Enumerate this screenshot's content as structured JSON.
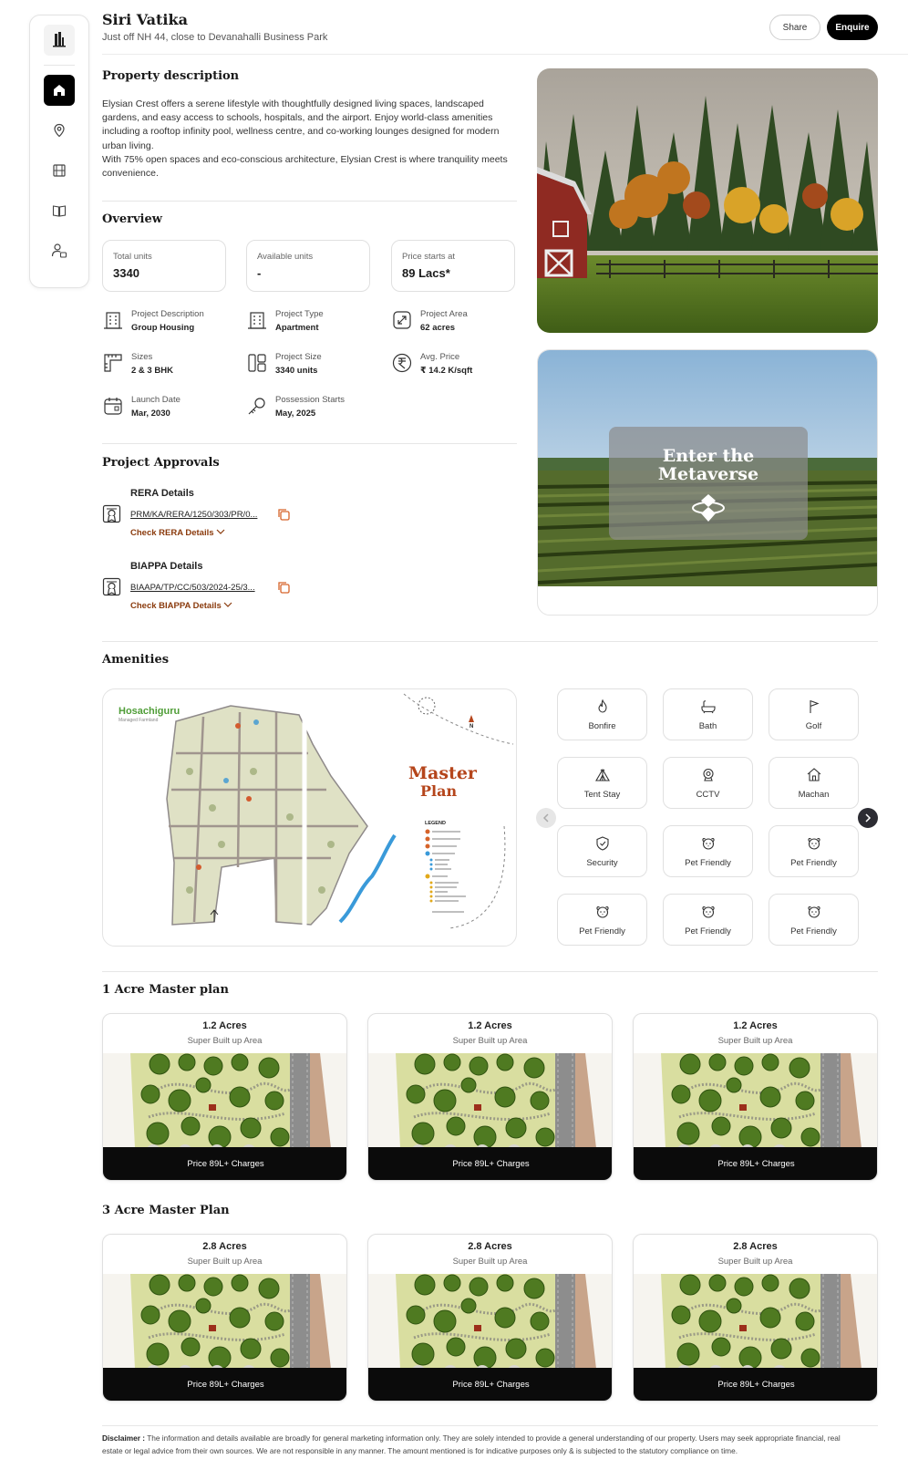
{
  "header": {
    "title": "Siri Vatika",
    "subtitle": "Just off NH 44, close to Devanahalli Business Park",
    "share_label": "Share",
    "enquire_label": "Enquire"
  },
  "sidebar": {
    "items": [
      {
        "icon": "home-icon",
        "active": true
      },
      {
        "icon": "location-pin-icon",
        "active": false
      },
      {
        "icon": "film-icon",
        "active": false
      },
      {
        "icon": "book-icon",
        "active": false
      },
      {
        "icon": "user-settings-icon",
        "active": false
      }
    ]
  },
  "description": {
    "title": "Property description",
    "para1": "Elysian Crest offers a serene lifestyle with thoughtfully designed living spaces, landscaped gardens, and easy access to schools, hospitals, and the airport. Enjoy world-class amenities including a rooftop infinity pool, wellness centre, and co-working lounges designed for modern urban living.",
    "para2": "With 75% open spaces and eco-conscious architecture, Elysian Crest is where tranquility meets convenience."
  },
  "overview": {
    "title": "Overview",
    "stats": [
      {
        "label": "Total units",
        "value": "3340"
      },
      {
        "label": "Available units",
        "value": "-"
      },
      {
        "label": "Price starts at",
        "value": "89 Lacs*"
      }
    ],
    "details": [
      {
        "label": "Project Description",
        "value": "Group Housing",
        "icon": "building-icon"
      },
      {
        "label": "Project Type",
        "value": "Apartment",
        "icon": "building-icon"
      },
      {
        "label": "Project Area",
        "value": "62 acres",
        "icon": "expand-icon"
      },
      {
        "label": "Sizes",
        "value": "2 & 3 BHK",
        "icon": "ruler-icon"
      },
      {
        "label": "Project Size",
        "value": "3340 units",
        "icon": "layout-icon"
      },
      {
        "label": "Avg. Price",
        "value": "₹ 14.2 K/sqft",
        "icon": "rupee-icon"
      },
      {
        "label": "Launch Date",
        "value": "Mar, 2030",
        "icon": "calendar-icon"
      },
      {
        "label": "Possession Starts",
        "value": "May, 2025",
        "icon": "key-icon"
      }
    ]
  },
  "approvals": {
    "title": "Project Approvals",
    "items": [
      {
        "title": "RERA Details",
        "number": "PRM/KA/RERA/1250/303/PR/0...",
        "link": "Check RERA Details"
      },
      {
        "title": "BIAPPA Details",
        "number": "BIAAPA/TP/CC/503/2024-25/3...",
        "link": "Check BIAPPA Details"
      }
    ]
  },
  "metaverse": {
    "label": "Enter the Metaverse"
  },
  "amenities": {
    "title": "Amenities",
    "map": {
      "brand": "Hosachiguru",
      "brand_sub": "Managed Farmland",
      "title_line1": "Master",
      "title_line2": "Plan",
      "legend_title": "LEGEND",
      "compass": "N"
    },
    "items": [
      {
        "label": "Bonfire",
        "icon": "fire-icon"
      },
      {
        "label": "Bath",
        "icon": "bathtub-icon"
      },
      {
        "label": "Golf",
        "icon": "flag-icon"
      },
      {
        "label": "Tent Stay",
        "icon": "tent-icon"
      },
      {
        "label": "CCTV",
        "icon": "camera-icon"
      },
      {
        "label": "Machan",
        "icon": "hut-icon"
      },
      {
        "label": "Security",
        "icon": "shield-icon"
      },
      {
        "label": "Pet Friendly",
        "icon": "dog-icon"
      },
      {
        "label": "Pet Friendly",
        "icon": "dog-icon"
      },
      {
        "label": "Pet Friendly",
        "icon": "dog-icon"
      },
      {
        "label": "Pet Friendly",
        "icon": "dog-icon"
      },
      {
        "label": "Pet Friendly",
        "icon": "dog-icon"
      }
    ]
  },
  "plan1": {
    "title": "1 Acre Master plan",
    "cards": [
      {
        "acres": "1.2 Acres",
        "area_label": "Super Built up Area",
        "price": "Price 89L+ Charges"
      },
      {
        "acres": "1.2 Acres",
        "area_label": "Super Built up Area",
        "price": "Price 89L+ Charges"
      },
      {
        "acres": "1.2 Acres",
        "area_label": "Super Built up Area",
        "price": "Price 89L+ Charges"
      }
    ]
  },
  "plan3": {
    "title": "3 Acre Master Plan",
    "cards": [
      {
        "acres": "2.8 Acres",
        "area_label": "Super Built up Area",
        "price": "Price 89L+ Charges"
      },
      {
        "acres": "2.8 Acres",
        "area_label": "Super Built up Area",
        "price": "Price 89L+ Charges"
      },
      {
        "acres": "2.8 Acres",
        "area_label": "Super Built up Area",
        "price": "Price 89L+ Charges"
      }
    ]
  },
  "disclaimer": {
    "label": "Disclaimer :",
    "text": "The information and details available are broadly for general marketing information only. They are solely intended to provide a general understanding of our property. Users may seek appropriate financial, real estate or legal advice from their own sources. We are not responsible in any manner. The amount mentioned is for indicative purposes only & is subjected to the statutory compliance on time."
  },
  "colors": {
    "accent": "#000000",
    "link": "#8a3a0c",
    "copy_icon": "#d6632a",
    "map_title": "#b5451b"
  }
}
